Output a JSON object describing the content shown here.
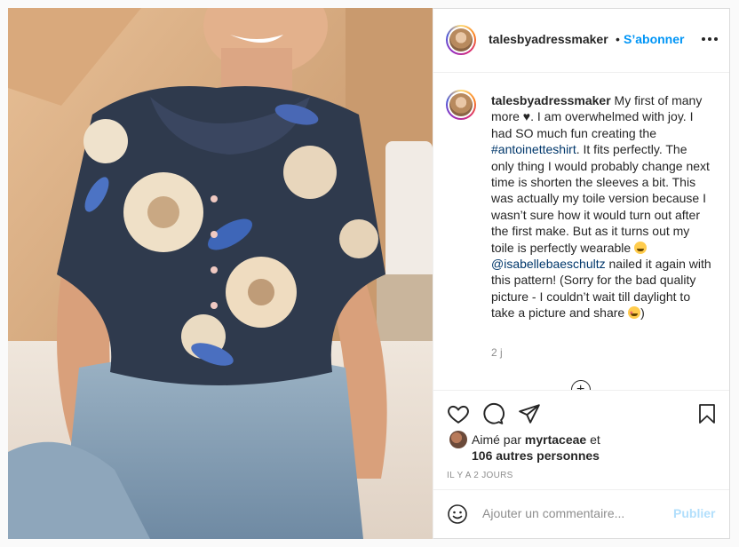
{
  "post": {
    "username": "talesbyadressmaker",
    "separator": "•",
    "follow_label": "S’abonner",
    "more_icon": "more-horizontal-icon"
  },
  "caption": {
    "username": "talesbyadressmaker",
    "text_1": " My first of many more ♥. I am overwhelmed with joy. I had SO much fun creating the ",
    "hashtag": "#antoinetteshirt",
    "text_2": ". It fits perfectly. The only thing I would probably change next time is shorten the sleeves a bit. This was actually my toile version because I wasn’t sure how it would turn out after the first make. But as it turns out my toile is perfectly wearable ",
    "mention": "@isabellebaeschultz",
    "text_3": " nailed it again with this pattern! (Sorry for the bad quality picture - I couldn’t wait till daylight to take a picture and share ",
    "text_4": ")",
    "time_short": "2 j"
  },
  "actions": {
    "liked_prefix": "Aimé par ",
    "liked_user": "myrtaceae",
    "liked_and": " et",
    "others": "106 autres personnes",
    "posted_ago": "IL Y A 2 JOURS"
  },
  "comment": {
    "placeholder": "Ajouter un commentaire...",
    "publish_label": "Publier"
  },
  "colors": {
    "link_blue": "#0095f6",
    "hashtag_blue": "#00376b",
    "muted": "#8e8e8e",
    "publish_disabled": "#b2dffc"
  }
}
